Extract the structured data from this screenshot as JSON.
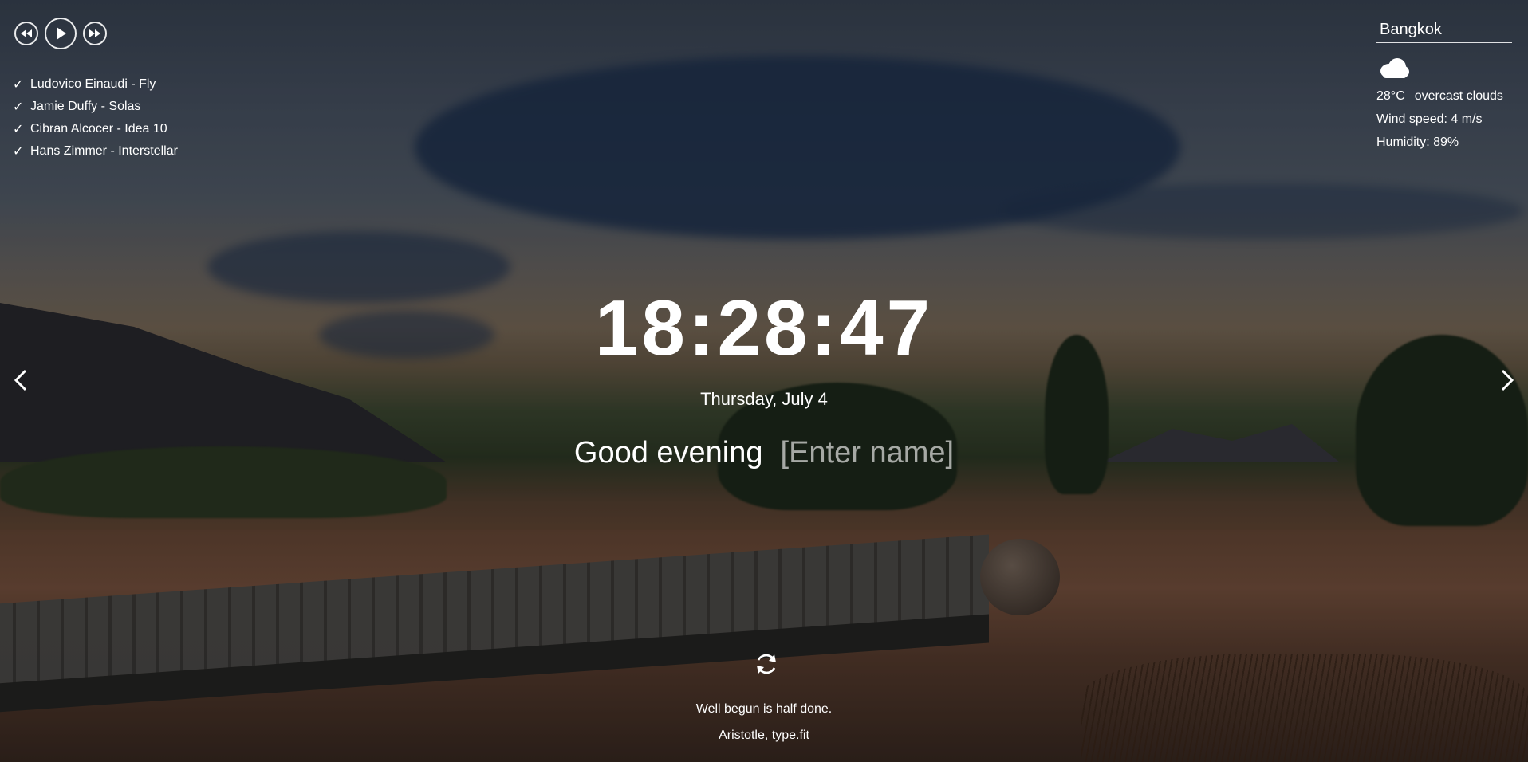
{
  "player": {
    "prev_icon": "rewind-icon",
    "play_icon": "play-icon",
    "next_icon": "fast-forward-icon"
  },
  "playlist": [
    {
      "check": "✓",
      "title": "Ludovico Einaudi - Fly"
    },
    {
      "check": "✓",
      "title": "Jamie Duffy - Solas"
    },
    {
      "check": "✓",
      "title": "Cibran Alcocer - Idea 10"
    },
    {
      "check": "✓",
      "title": "Hans Zimmer - Interstellar"
    }
  ],
  "weather": {
    "city": "Bangkok",
    "icon": "cloud-icon",
    "temperature": "28°C",
    "description": "overcast clouds",
    "wind": "Wind speed: 4 m/s",
    "humidity": "Humidity: 89%"
  },
  "clock": {
    "time": "18:28:47",
    "date": "Thursday, July 4"
  },
  "greeting": {
    "text": "Good evening",
    "name_placeholder": "[Enter name]"
  },
  "quote": {
    "refresh_icon": "refresh-icon",
    "text": "Well begun is half done.",
    "author": "Aristotle, type.fit"
  },
  "navigation": {
    "prev_icon": "chevron-left-icon",
    "next_icon": "chevron-right-icon"
  },
  "colors": {
    "text": "#ffffff",
    "placeholder": "#c8c8c8"
  }
}
